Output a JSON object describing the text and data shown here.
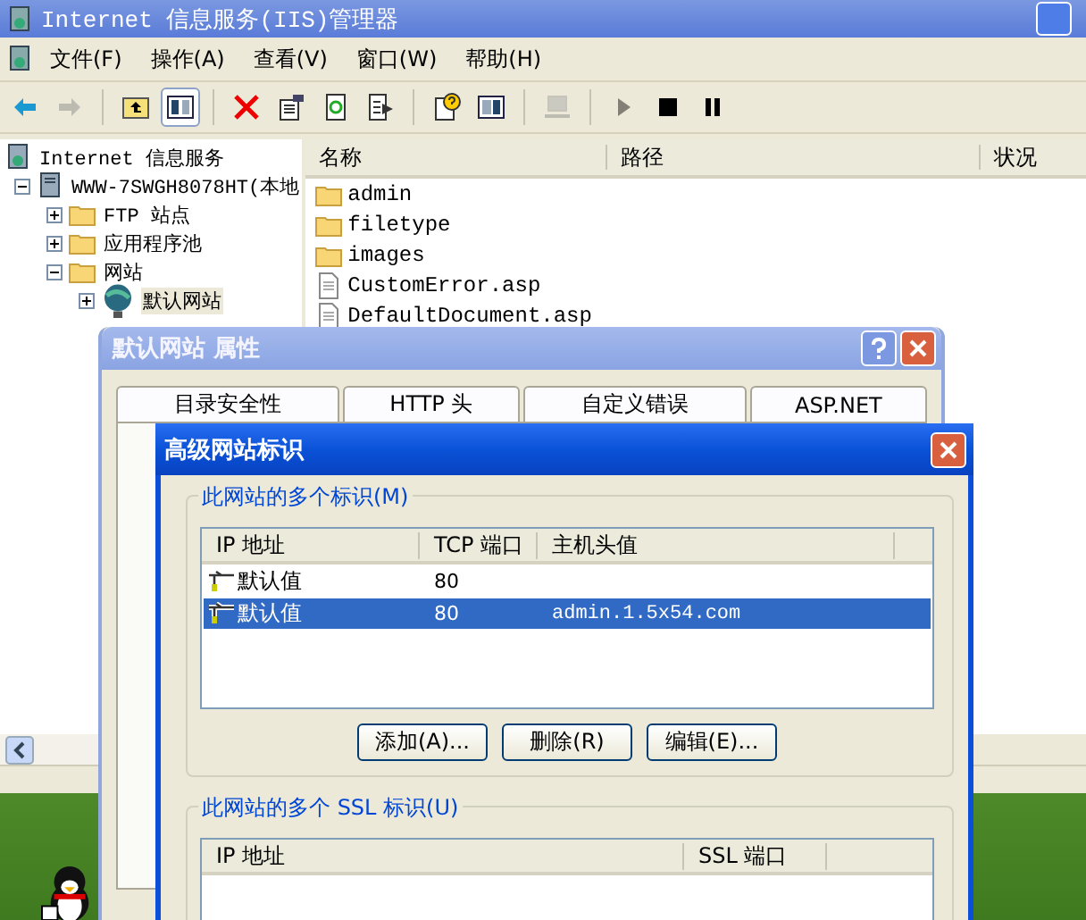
{
  "main_window": {
    "title": "Internet 信息服务(IIS)管理器",
    "menu": [
      "文件(F)",
      "操作(A)",
      "查看(V)",
      "窗口(W)",
      "帮助(H)"
    ],
    "toolbar": [
      [
        {
          "kind": "back",
          "disabled": false,
          "pressed": false
        },
        {
          "kind": "forward",
          "disabled": true,
          "pressed": false
        }
      ],
      [
        {
          "kind": "up",
          "disabled": false,
          "pressed": false
        },
        {
          "kind": "tree",
          "disabled": false,
          "pressed": true
        }
      ],
      [
        {
          "kind": "delete",
          "disabled": false,
          "pressed": false
        },
        {
          "kind": "properties",
          "disabled": false,
          "pressed": false
        },
        {
          "kind": "refresh",
          "disabled": false,
          "pressed": false
        },
        {
          "kind": "export",
          "disabled": false,
          "pressed": false
        }
      ],
      [
        {
          "kind": "help",
          "disabled": false,
          "pressed": false
        },
        {
          "kind": "panel",
          "disabled": false,
          "pressed": false
        }
      ],
      [
        {
          "kind": "computer",
          "disabled": true,
          "pressed": false
        }
      ],
      [
        {
          "kind": "play",
          "disabled": true,
          "pressed": false
        },
        {
          "kind": "stop",
          "disabled": false,
          "pressed": false
        },
        {
          "kind": "pause",
          "disabled": false,
          "pressed": false
        }
      ]
    ],
    "tree": [
      {
        "label": "Internet 信息服务",
        "kind": "iis",
        "selected": false,
        "children": [
          {
            "label": "WWW-7SWGH8078HT(本地",
            "kind": "server",
            "expanded": true,
            "selected": false,
            "children": [
              {
                "label": "FTP 站点",
                "kind": "folder",
                "expanded": false,
                "selected": false
              },
              {
                "label": "应用程序池",
                "kind": "folder",
                "expanded": false,
                "selected": false
              },
              {
                "label": "网站",
                "kind": "folder",
                "expanded": true,
                "selected": false,
                "children": [
                  {
                    "label": "默认网站",
                    "kind": "globe",
                    "expanded": false,
                    "selected": true
                  }
                ]
              }
            ]
          }
        ]
      }
    ],
    "list": {
      "columns": [
        "名称",
        "路径",
        "状况"
      ],
      "rows": [
        {
          "kind": "folder",
          "name": "admin"
        },
        {
          "kind": "folder",
          "name": "filetype"
        },
        {
          "kind": "folder",
          "name": "images"
        },
        {
          "kind": "file",
          "name": "CustomError.asp"
        },
        {
          "kind": "file",
          "name": "DefaultDocument.asp"
        }
      ]
    }
  },
  "properties_dialog": {
    "title": "默认网站 属性",
    "tabs": [
      {
        "label": "目录安全性",
        "selected": false
      },
      {
        "label": "HTTP 头",
        "selected": false
      },
      {
        "label": "自定义错误",
        "selected": false
      },
      {
        "label": "ASP.NET",
        "selected": false
      }
    ]
  },
  "advanced_dialog": {
    "title": "高级网站标识",
    "identities": {
      "legend": "此网站的多个标识(M)",
      "columns": [
        "IP 地址",
        "TCP 端口",
        "主机头值"
      ],
      "rows": [
        {
          "ip": "默认值",
          "port": "80",
          "host": "",
          "selected": false
        },
        {
          "ip": "默认值",
          "port": "80",
          "host": "admin.1.5x54.com",
          "selected": true
        }
      ]
    },
    "buttons": [
      "添加(A)...",
      "删除(R)",
      "编辑(E)..."
    ],
    "ssl": {
      "legend": "此网站的多个 SSL 标识(U)",
      "columns": [
        "IP 地址",
        "SSL 端口"
      ]
    }
  }
}
